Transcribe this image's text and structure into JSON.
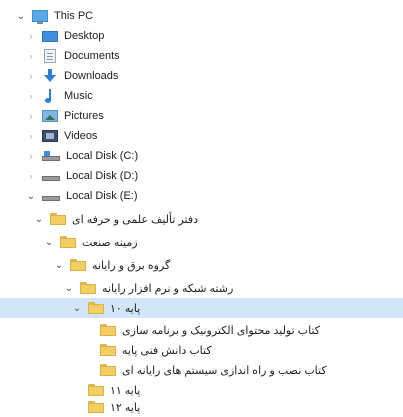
{
  "tree": {
    "items": [
      {
        "label": "This PC",
        "chevron": "open",
        "icon": "pc-icon",
        "rtl": false
      },
      {
        "label": "Desktop",
        "chevron": "closed",
        "icon": "desktop-icon",
        "rtl": false
      },
      {
        "label": "Documents",
        "chevron": "closed",
        "icon": "documents-icon",
        "rtl": false
      },
      {
        "label": "Downloads",
        "chevron": "closed",
        "icon": "downloads-icon",
        "rtl": false
      },
      {
        "label": "Music",
        "chevron": "closed",
        "icon": "music-icon",
        "rtl": false
      },
      {
        "label": "Pictures",
        "chevron": "closed",
        "icon": "pictures-icon",
        "rtl": false
      },
      {
        "label": "Videos",
        "chevron": "closed",
        "icon": "videos-icon",
        "rtl": false
      },
      {
        "label": "Local Disk (C:)",
        "chevron": "closed",
        "icon": "local-disk-os-icon",
        "rtl": false
      },
      {
        "label": "Local Disk (D:)",
        "chevron": "closed",
        "icon": "local-disk-icon",
        "rtl": false
      },
      {
        "label": "Local Disk (E:)",
        "chevron": "open",
        "icon": "local-disk-icon",
        "rtl": false
      },
      {
        "label": "دفتر تألیف علمی و حرفه ای",
        "chevron": "open",
        "icon": "folder-icon",
        "rtl": true
      },
      {
        "label": "زمینه صنعت",
        "chevron": "open",
        "icon": "folder-icon",
        "rtl": true
      },
      {
        "label": "گروه برق و رایانه",
        "chevron": "open",
        "icon": "folder-icon",
        "rtl": true
      },
      {
        "label": "رشته شبکه و نرم افزار رایانه",
        "chevron": "open",
        "icon": "folder-icon",
        "rtl": true
      },
      {
        "label": "پایه ۱۰",
        "chevron": "open",
        "icon": "folder-icon",
        "rtl": true,
        "selected": true
      },
      {
        "label": "کتاب تولید محتوای الکترونیک و برنامه سازی",
        "chevron": "none",
        "icon": "folder-icon",
        "rtl": true
      },
      {
        "label": "کتاب دانش فنی پایه",
        "chevron": "none",
        "icon": "folder-icon",
        "rtl": true
      },
      {
        "label": "کتاب نصب و راه اندازی سیستم های رایانه ای",
        "chevron": "none",
        "icon": "folder-icon",
        "rtl": true
      },
      {
        "label": "پایه ۱۱",
        "chevron": "none",
        "icon": "folder-icon",
        "rtl": true
      },
      {
        "label": "پایه ۱۲",
        "chevron": "none",
        "icon": "folder-icon",
        "rtl": true
      }
    ]
  }
}
